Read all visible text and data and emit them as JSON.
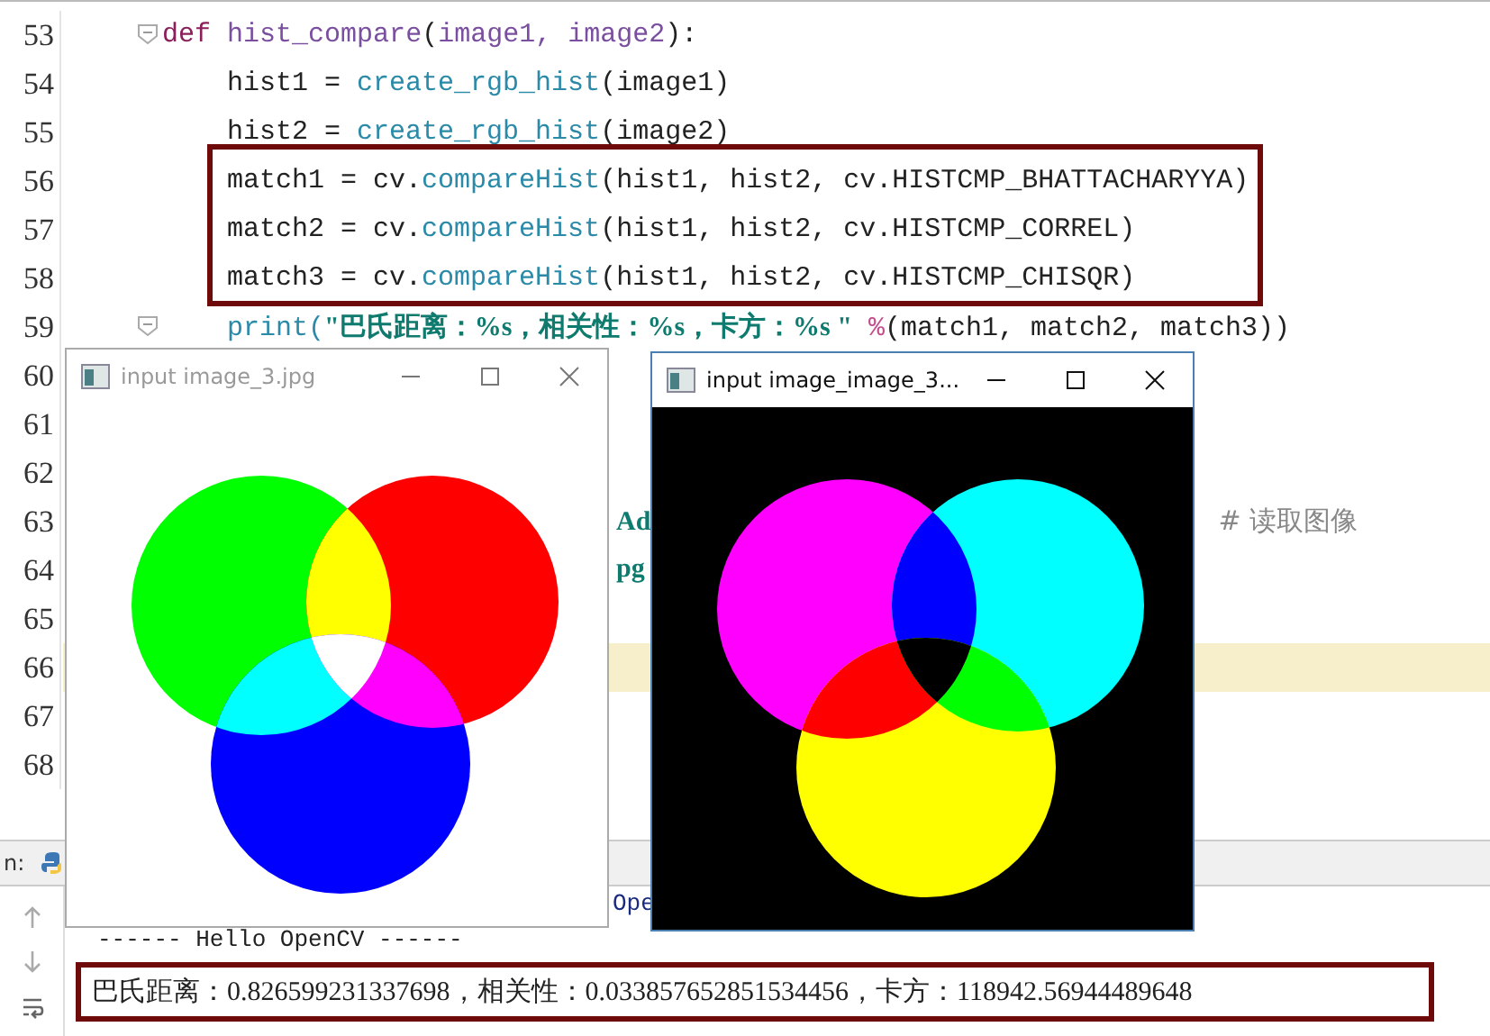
{
  "editor": {
    "lines": [
      {
        "number": "53",
        "current": false,
        "fold": true,
        "segments": [
          {
            "text": "    def",
            "kind": "keyword"
          },
          {
            "text": " hist_compare",
            "kind": "name"
          },
          {
            "text": "(",
            "kind": "plain"
          },
          {
            "text": "image1, image2",
            "kind": "param"
          },
          {
            "text": "):",
            "kind": "plain"
          }
        ]
      },
      {
        "number": "54",
        "current": false,
        "fold": false,
        "segments": [
          {
            "text": "        hist1 = ",
            "kind": "plain"
          },
          {
            "text": "create_rgb_hist",
            "kind": "call"
          },
          {
            "text": "(image1)",
            "kind": "plain"
          }
        ]
      },
      {
        "number": "55",
        "current": false,
        "fold": false,
        "segments": [
          {
            "text": "        hist2 = ",
            "kind": "plain"
          },
          {
            "text": "create_rgb_hist",
            "kind": "call"
          },
          {
            "text": "(image2)",
            "kind": "plain"
          }
        ]
      },
      {
        "number": "56",
        "current": false,
        "fold": false,
        "segments": [
          {
            "text": "        match1 = cv.",
            "kind": "plain"
          },
          {
            "text": "compareHist",
            "kind": "call"
          },
          {
            "text": "(hist1, hist2, cv.HISTCMP_BHATTACHARYYA)",
            "kind": "plain"
          }
        ]
      },
      {
        "number": "57",
        "current": false,
        "fold": false,
        "segments": [
          {
            "text": "        match2 = cv.",
            "kind": "plain"
          },
          {
            "text": "compareHist",
            "kind": "call"
          },
          {
            "text": "(hist1, hist2, cv.HISTCMP_CORREL)",
            "kind": "plain"
          }
        ]
      },
      {
        "number": "58",
        "current": false,
        "fold": false,
        "segments": [
          {
            "text": "        match3 = cv.",
            "kind": "plain"
          },
          {
            "text": "compareHist",
            "kind": "call"
          },
          {
            "text": "(hist1, hist2, cv.HISTCMP_CHISQR)",
            "kind": "plain"
          }
        ]
      },
      {
        "number": "59",
        "current": false,
        "fold": true,
        "segments": [
          {
            "text": "        print(",
            "kind": "call"
          },
          {
            "text": "\"巴氏距离：%s，相关性：%s，卡方：%s \"",
            "kind": "string"
          },
          {
            "text": " %",
            "kind": "percent"
          },
          {
            "text": "(match1, match2, match3))",
            "kind": "plain"
          }
        ]
      },
      {
        "number": "60",
        "current": false,
        "fold": false
      },
      {
        "number": "61",
        "current": false,
        "fold": false
      },
      {
        "number": "62",
        "current": false,
        "fold": false
      },
      {
        "number": "63",
        "current": false,
        "fold": false,
        "segments": [
          {
            "text": "                                Ad",
            "kind": "string"
          },
          {
            "text": "                                   # 读取图像",
            "kind": "comment"
          }
        ]
      },
      {
        "number": "64",
        "current": false,
        "fold": false,
        "segments": [
          {
            "text": "                                pg",
            "kind": "string"
          }
        ]
      },
      {
        "number": "65",
        "current": false,
        "fold": false
      },
      {
        "number": "66",
        "current": true,
        "fold": false
      },
      {
        "number": "67",
        "current": false,
        "fold": false
      },
      {
        "number": "68",
        "current": false,
        "fold": false
      }
    ]
  },
  "windows": [
    {
      "title": "input image_3.jpg",
      "active": false
    },
    {
      "title": "input image_image_3...",
      "active": true
    }
  ],
  "run_panel": {
    "label": "n:",
    "console": [
      "Ope",
      "------ Hello OpenCV ------"
    ],
    "result": "巴氏距离：0.826599231337698，相关性：0.033857652851534456，卡方：118942.56944489648"
  }
}
